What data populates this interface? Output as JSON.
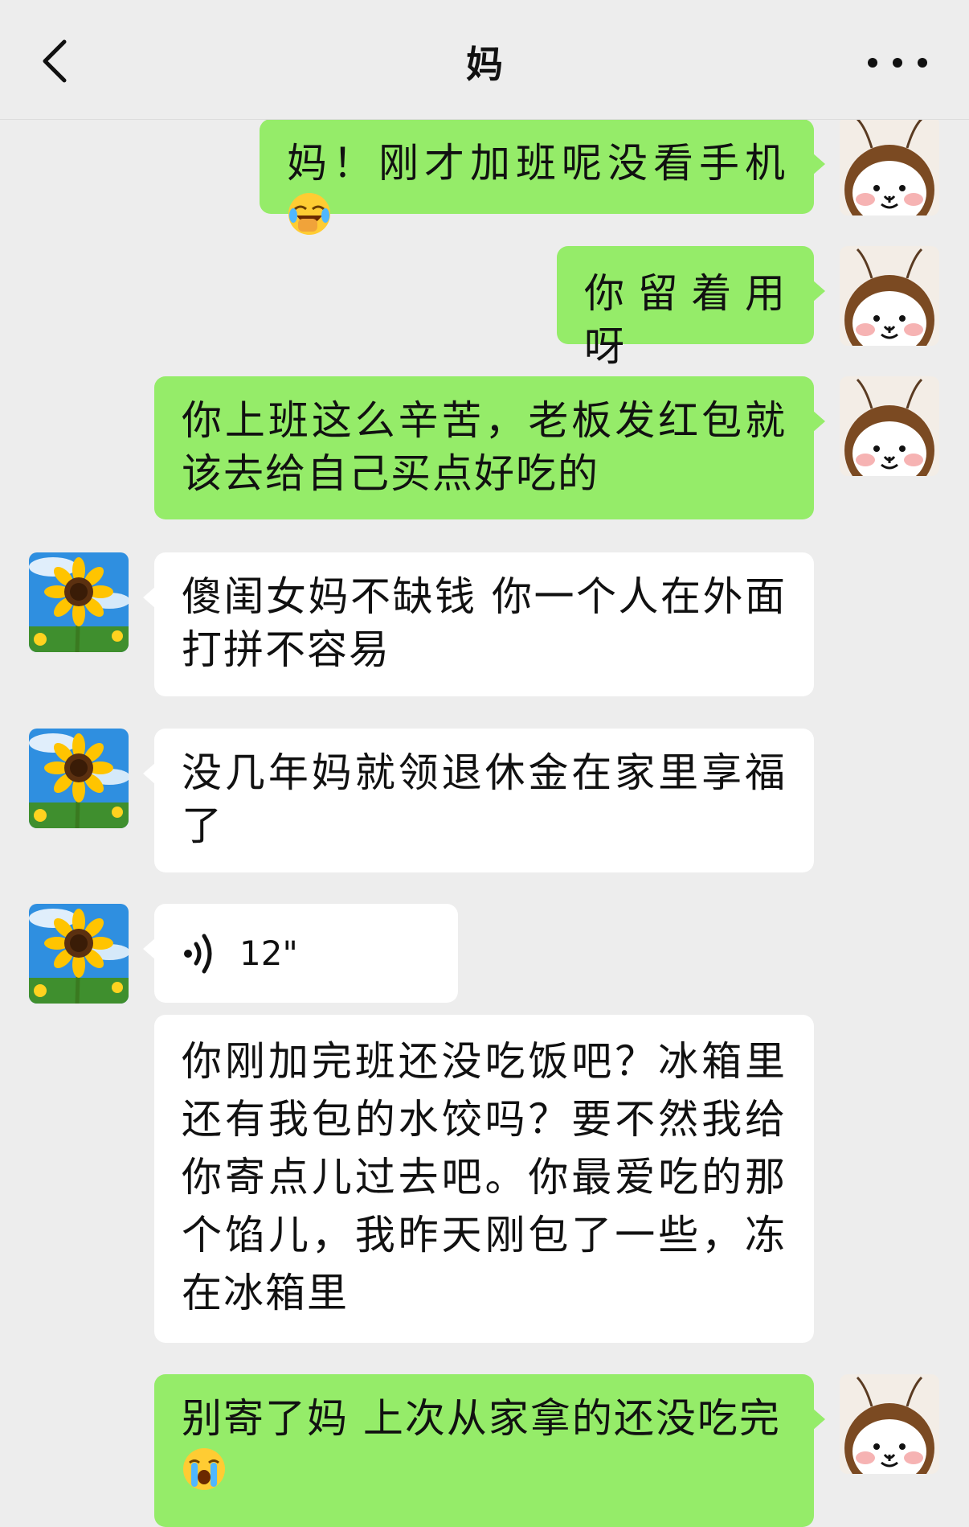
{
  "header": {
    "title": "妈",
    "back_icon": "chevron-left-icon",
    "more_icon": "more-dots-icon"
  },
  "colors": {
    "outgoing_bubble": "#95ec69",
    "incoming_bubble": "#ffffff",
    "background": "#ededed"
  },
  "messages": [
    {
      "sender": "me",
      "text": "妈！刚才加班呢没看手机",
      "emoji": "face-with-tears-of-joy"
    },
    {
      "sender": "me",
      "text": "你留着用呀"
    },
    {
      "sender": "me",
      "text": "你上班这么辛苦，老板发红包就该去给自己买点好吃的"
    },
    {
      "sender": "mom",
      "text": "傻闺女妈不缺钱 你一个人在外面打拼不容易"
    },
    {
      "sender": "mom",
      "text": "没几年妈就领退休金在家里享福了"
    },
    {
      "sender": "mom",
      "type": "voice",
      "duration": "12\""
    },
    {
      "sender": "mom",
      "text": "你刚加完班还没吃饭吧？冰箱里还有我包的水饺吗？要不然我给你寄点儿过去吧。你最爱吃的那个馅儿，我昨天刚包了一些，冻在冰箱里"
    },
    {
      "sender": "me",
      "text": "别寄了妈 上次从家拿的还没吃完",
      "emoji": "loudly-crying-face"
    }
  ]
}
